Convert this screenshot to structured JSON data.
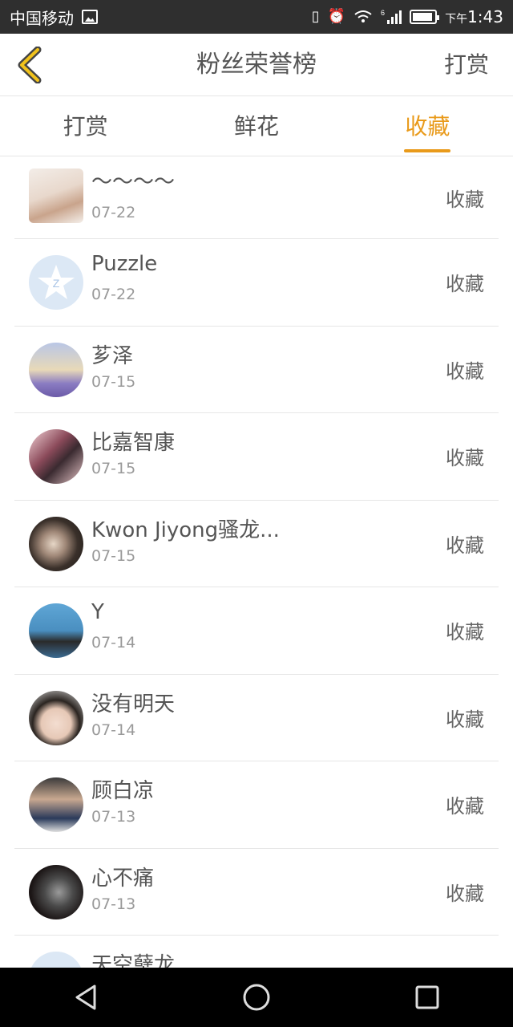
{
  "status_bar": {
    "carrier": "中国移动",
    "time_prefix": "下午",
    "time": "1:43",
    "network_label": "6"
  },
  "header": {
    "title": "粉丝荣誉榜",
    "action": "打赏",
    "accent": "#e99a1a"
  },
  "tabs": [
    {
      "label": "打赏",
      "active": false
    },
    {
      "label": "鲜花",
      "active": false
    },
    {
      "label": "收藏",
      "active": true
    }
  ],
  "fans": [
    {
      "name": "～～～～",
      "date": "07-22",
      "action": "收藏"
    },
    {
      "name": "Puzzle",
      "date": "07-22",
      "action": "收藏"
    },
    {
      "name": "芗泽",
      "date": "07-15",
      "action": "收藏"
    },
    {
      "name": "比嘉智康",
      "date": "07-15",
      "action": "收藏"
    },
    {
      "name": "Kwon Jiyong骚龙...",
      "date": "07-15",
      "action": "收藏"
    },
    {
      "name": "Y",
      "date": "07-14",
      "action": "收藏"
    },
    {
      "name": "没有明天",
      "date": "07-14",
      "action": "收藏"
    },
    {
      "name": "顾白凉",
      "date": "07-13",
      "action": "收藏"
    },
    {
      "name": "心不痛",
      "date": "07-13",
      "action": "收藏"
    },
    {
      "name": "天空蘖龙",
      "date": "",
      "action": ""
    }
  ]
}
